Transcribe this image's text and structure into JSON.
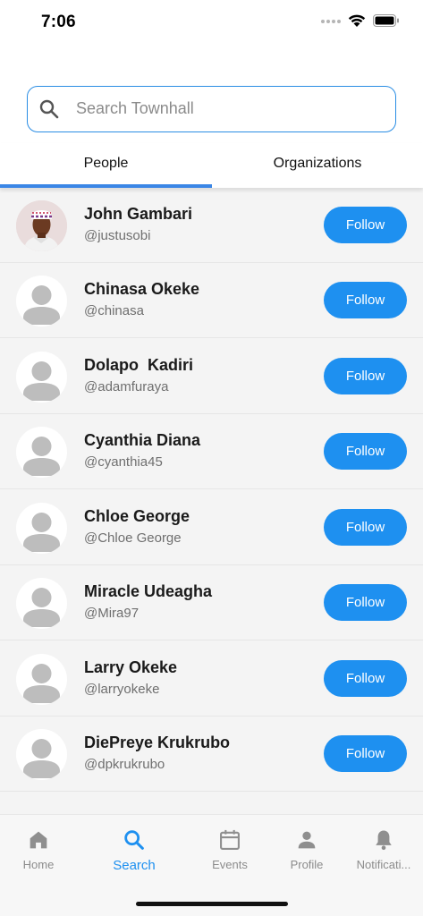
{
  "status_bar": {
    "time": "7:06"
  },
  "search": {
    "placeholder": "Search Townhall",
    "value": ""
  },
  "tabs": [
    {
      "label": "People",
      "active": true
    },
    {
      "label": "Organizations",
      "active": false
    }
  ],
  "people": [
    {
      "name": "John Gambari",
      "handle": "@justusobi",
      "button": "Follow",
      "avatar": "photo"
    },
    {
      "name": "Chinasa Okeke",
      "handle": "@chinasa",
      "button": "Follow",
      "avatar": "default-avatar-icon"
    },
    {
      "name": "Dolapo  Kadiri",
      "handle": "@adamfuraya",
      "button": "Follow",
      "avatar": "default-avatar-icon"
    },
    {
      "name": "Cyanthia Diana",
      "handle": "@cyanthia45",
      "button": "Follow",
      "avatar": "default-avatar-icon"
    },
    {
      "name": "Chloe George",
      "handle": "@Chloe George",
      "button": "Follow",
      "avatar": "default-avatar-icon"
    },
    {
      "name": "Miracle Udeagha",
      "handle": "@Mira97",
      "button": "Follow",
      "avatar": "default-avatar-icon"
    },
    {
      "name": "Larry Okeke",
      "handle": "@larryokeke",
      "button": "Follow",
      "avatar": "default-avatar-icon"
    },
    {
      "name": "DiePreye Krukrubo",
      "handle": "@dpkrukrubo",
      "button": "Follow",
      "avatar": "default-avatar-icon"
    }
  ],
  "bottom_nav": [
    {
      "label": "Home",
      "icon": "home-icon",
      "active": false
    },
    {
      "label": "Search",
      "icon": "search-icon",
      "active": true
    },
    {
      "label": "Events",
      "icon": "calendar-icon",
      "active": false
    },
    {
      "label": "Profile",
      "icon": "person-icon",
      "active": false
    },
    {
      "label": "Notificati...",
      "icon": "bell-icon",
      "active": false
    }
  ],
  "colors": {
    "accent": "#1e90f0",
    "tab_indicator": "#3a86e6",
    "search_border": "#2a8de4",
    "list_bg": "#f4f4f4"
  }
}
